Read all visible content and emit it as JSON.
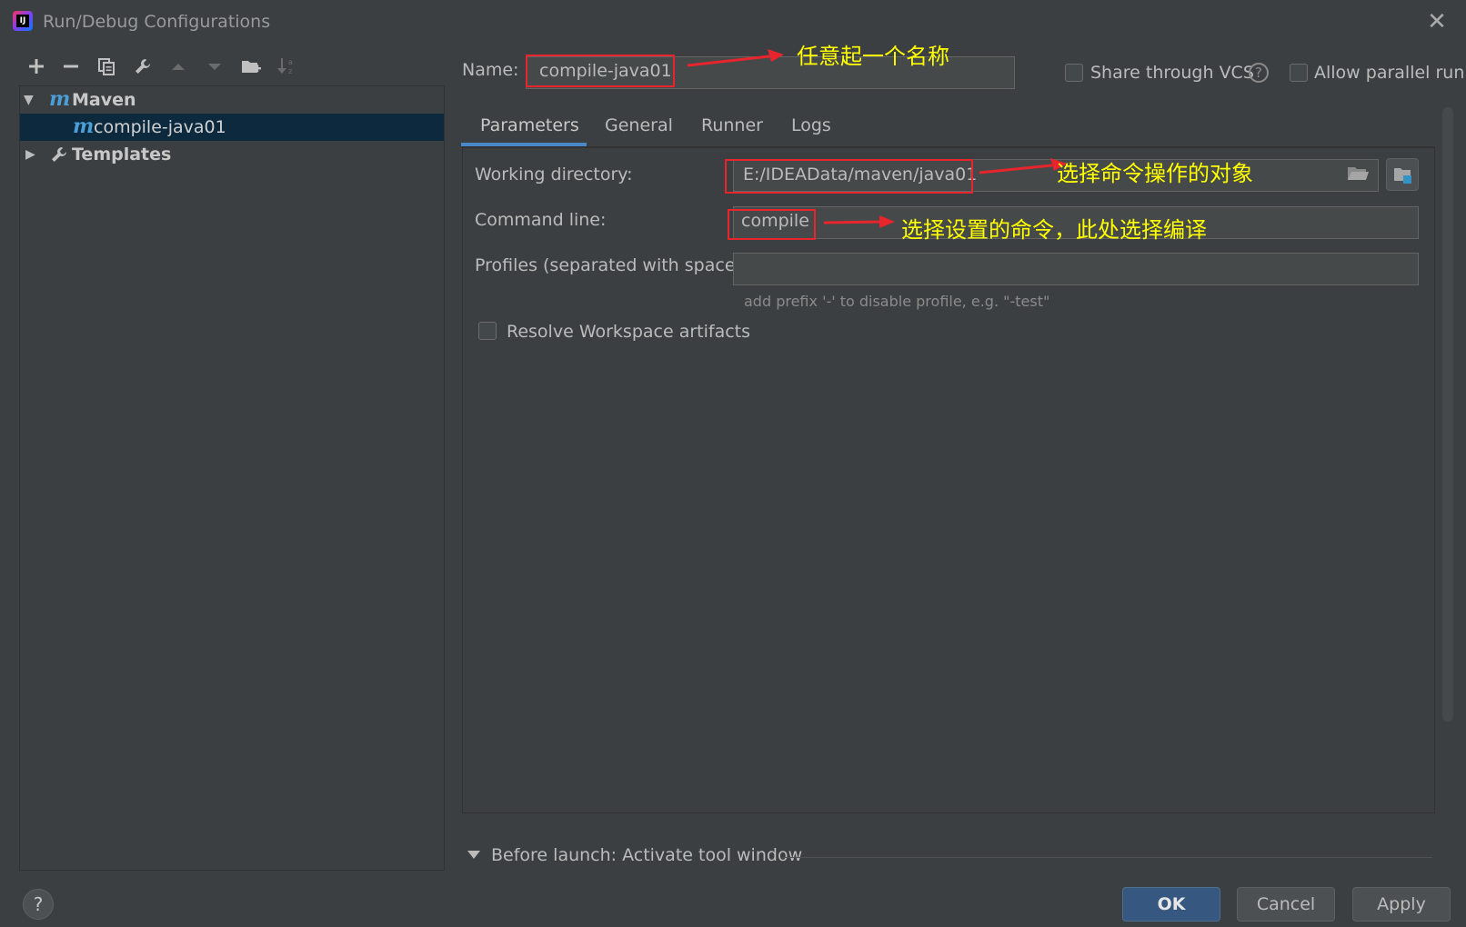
{
  "window": {
    "title": "Run/Debug Configurations",
    "logo_text": "IJ"
  },
  "toolbar": {
    "icons": [
      "add-icon",
      "remove-icon",
      "copy-icon",
      "wrench-icon",
      "move-up-icon",
      "move-down-icon",
      "new-folder-icon",
      "sort-icon"
    ]
  },
  "tree": {
    "items": [
      {
        "label": "Maven",
        "expanded": true
      },
      {
        "label": "compile-java01",
        "selected": true
      },
      {
        "label": "Templates",
        "expanded": false
      }
    ]
  },
  "header": {
    "name_label": "Name:",
    "name_value": "compile-java01",
    "share_label": "Share through VCS",
    "parallel_label": "Allow parallel run"
  },
  "tabs": [
    "Parameters",
    "General",
    "Runner",
    "Logs"
  ],
  "form": {
    "working_dir_label": "Working directory:",
    "working_dir_value": "E:/IDEAData/maven/java01",
    "command_line_label": "Command line:",
    "command_line_value": "compile",
    "profiles_label": "Profiles (separated with space):",
    "profiles_value": "",
    "profiles_hint": "add prefix '-' to disable profile, e.g. \"-test\"",
    "resolve_label": "Resolve Workspace artifacts"
  },
  "before_launch": {
    "label": "Before launch: Activate tool window"
  },
  "buttons": {
    "ok": "OK",
    "cancel": "Cancel",
    "apply": "Apply",
    "help": "?"
  },
  "annotations": {
    "name_note": "任意起一个名称",
    "working_dir_note": "选择命令操作的对象",
    "command_note": "选择设置的命令，此处选择编译"
  },
  "colors": {
    "accent": "#4a88c7",
    "selection": "#0d293e",
    "annotation_red": "#e8242c",
    "annotation_yellow": "#ffff00"
  }
}
